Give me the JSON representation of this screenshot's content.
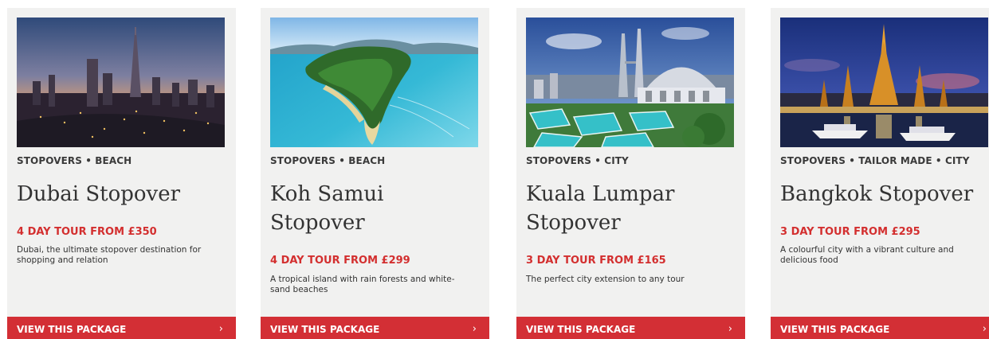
{
  "cards": [
    {
      "tags": "STOPOVERS • BEACH",
      "title": "Dubai Stopover",
      "price": "4 DAY TOUR FROM £350",
      "description": "Dubai, the ultimate stopover destination for shopping and relation",
      "cta": "VIEW THIS PACKAGE",
      "chevron": "›"
    },
    {
      "tags": "STOPOVERS • BEACH",
      "title": "Koh Samui Stopover",
      "price": "4 DAY TOUR FROM £299",
      "description": "A tropical island with rain forests and white-sand beaches",
      "cta": "VIEW THIS PACKAGE",
      "chevron": "›"
    },
    {
      "tags": "STOPOVERS • CITY",
      "title": "Kuala Lumpar Stopover",
      "price": "3 DAY TOUR FROM £165",
      "description": "The perfect city extension to any tour",
      "cta": "VIEW THIS PACKAGE",
      "chevron": "›"
    },
    {
      "tags": "STOPOVERS • TAILOR MADE • CITY",
      "title": "Bangkok Stopover",
      "price": "3 DAY TOUR FROM £295",
      "description": "A colourful city with a vibrant culture and delicious food",
      "cta": "VIEW THIS PACKAGE",
      "chevron": "›"
    }
  ],
  "colors": {
    "card_bg": "#f1f1f0",
    "accent_red": "#d32f35",
    "text_dark": "#333333"
  }
}
